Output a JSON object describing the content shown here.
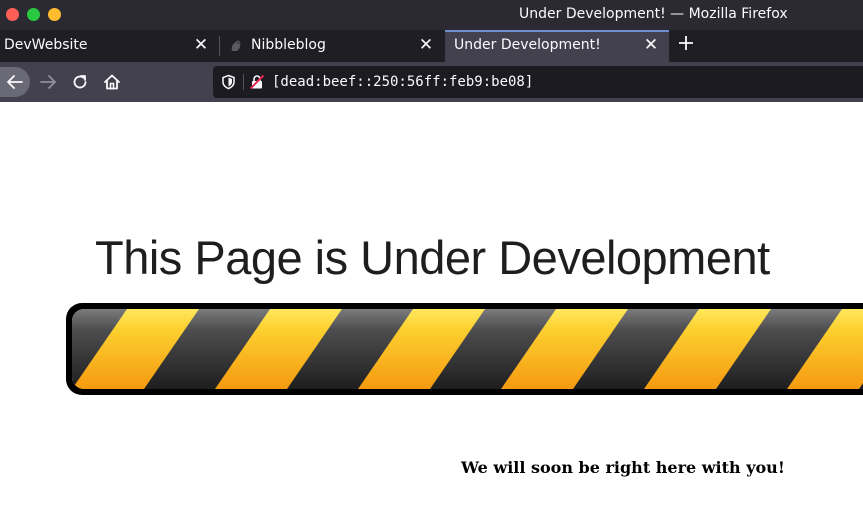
{
  "window": {
    "title": "Under Development! — Mozilla Firefox"
  },
  "tabs": [
    {
      "label": "DevWebsite",
      "active": false
    },
    {
      "label": "Nibbleblog",
      "active": false
    },
    {
      "label": "Under Development!",
      "active": true
    }
  ],
  "toolbar": {
    "back": "back-arrow-icon",
    "forward": "forward-arrow-icon",
    "reload": "reload-icon",
    "home": "home-icon",
    "new_tab": "plus-icon"
  },
  "url_bar": {
    "url": "[dead:beef::250:56ff:feb9:be08]",
    "shield": "tracking-protection-shield-icon",
    "security": "insecure-lock-icon"
  },
  "page": {
    "heading": "This Page is Under Development",
    "tagline": "We will soon be right here with you!",
    "bar_colors": {
      "yellow": "#f7b81c",
      "dark": "#2e2e30"
    }
  }
}
